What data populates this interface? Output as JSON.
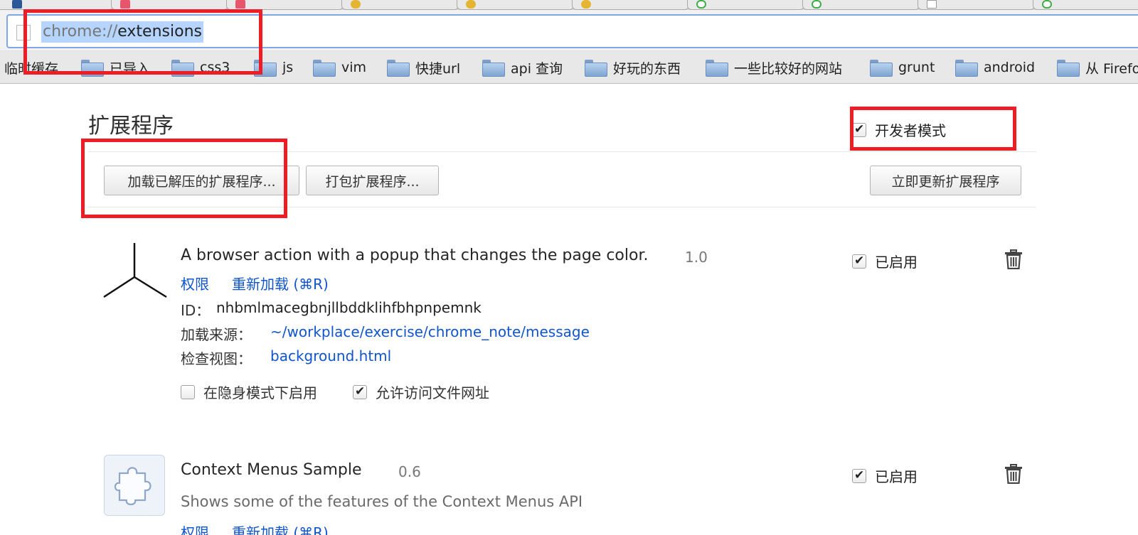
{
  "omnibox": {
    "url_scheme": "chrome://",
    "url_host": "extensions"
  },
  "bookmarks": [
    {
      "label": "临时缓存",
      "folder": false
    },
    {
      "label": "已导入",
      "folder": true
    },
    {
      "label": "css3",
      "folder": true
    },
    {
      "label": "js",
      "folder": true
    },
    {
      "label": "vim",
      "folder": true
    },
    {
      "label": "快捷url",
      "folder": true
    },
    {
      "label": "api 查询",
      "folder": true
    },
    {
      "label": "好玩的东西",
      "folder": true
    },
    {
      "label": "一些比较好的网站",
      "folder": true
    },
    {
      "label": "grunt",
      "folder": true
    },
    {
      "label": "android",
      "folder": true
    },
    {
      "label": "从 Firefox",
      "folder": true
    }
  ],
  "page": {
    "title": "扩展程序",
    "dev_mode_label": "开发者模式",
    "dev_mode_checked": true,
    "load_unpacked_button": "加载已解压的扩展程序...",
    "pack_button": "打包扩展程序...",
    "update_button": "立即更新扩展程序"
  },
  "extensions": [
    {
      "name": "A browser action with a popup that changes the page color.",
      "version": "1.0",
      "permissions_link": "权限",
      "reload_link": "重新加载 (⌘R)",
      "id_label": "ID：",
      "id_value": "nhbmlmacegbnjllbddklihfbhpnpemnk",
      "source_label": "加载来源：",
      "source_value": "~/workplace/exercise/chrome_note/message",
      "inspect_label": "检查视图：",
      "inspect_value": "background.html",
      "incognito_label": "在隐身模式下启用",
      "incognito_checked": false,
      "file_access_label": "允许访问文件网址",
      "file_access_checked": true,
      "enabled_label": "已启用",
      "enabled": true
    },
    {
      "name": "Context Menus Sample",
      "version": "0.6",
      "description": "Shows some of the features of the Context Menus API",
      "permissions_link": "权限",
      "reload_link": "重新加载 (⌘R)",
      "enabled_label": "已启用",
      "enabled": true
    }
  ],
  "colors": {
    "link": "#1155cc",
    "annotation": "#ee1c24",
    "selection": "#b5d5ff"
  }
}
